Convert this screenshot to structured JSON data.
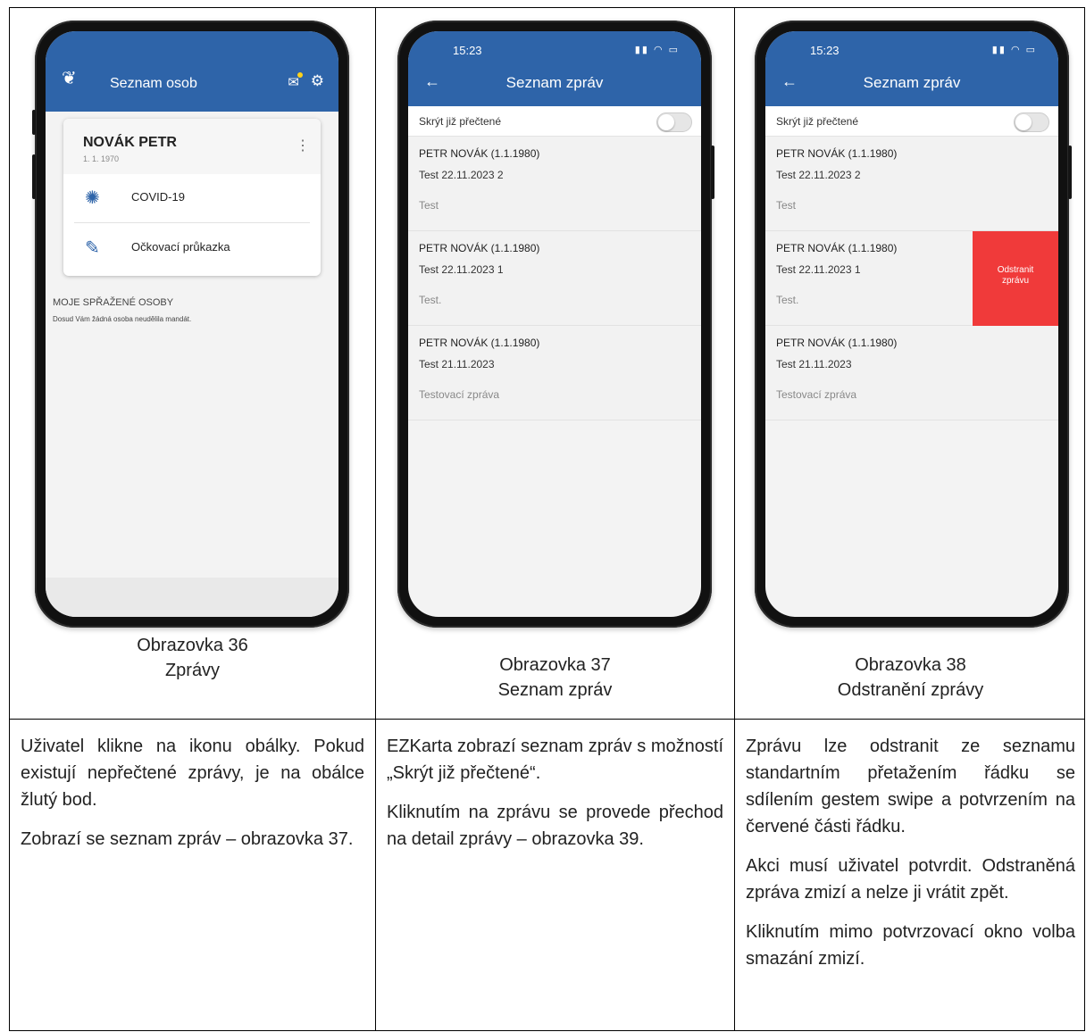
{
  "screens": [
    {
      "caption_line1": "Obrazovka 36",
      "caption_line2": "Zprávy",
      "app_title": "Seznam osob",
      "person_name": "NOVÁK PETR",
      "person_date": "1. 1. 1970",
      "items": [
        "COVID-19",
        "Očkovací průkazka"
      ],
      "linked_title": "MOJE SPŘAŽENÉ OSOBY",
      "linked_text": "Dosud Vám žádná osoba neudělila mandát.",
      "description": [
        "Uživatel klikne na ikonu obálky. Pokud existují nepřečtené zprávy, je na obálce žlutý bod.",
        "Zobrazí se seznam zpráv – obrazovka 37."
      ]
    },
    {
      "caption_line1": "Obrazovka 37",
      "caption_line2": "Seznam zpráv",
      "status_time": "15:23",
      "app_title": "Seznam zpráv",
      "toggle_label": "Skrýt již přečtené",
      "messages": [
        {
          "sender": "PETR NOVÁK (1.1.1980)",
          "subject": "Test 22.11.2023 2",
          "body": "Test"
        },
        {
          "sender": "PETR NOVÁK (1.1.1980)",
          "subject": "Test 22.11.2023 1",
          "body": "Test."
        },
        {
          "sender": "PETR NOVÁK (1.1.1980)",
          "subject": "Test 21.11.2023",
          "body": "Testovací zpráva"
        }
      ],
      "description": [
        "EZKarta zobrazí seznam zpráv s možností „Skrýt již přečtené“.",
        "Kliknutím na zprávu se provede přechod na detail zprávy – obrazovka 39."
      ]
    },
    {
      "caption_line1": "Obrazovka 38",
      "caption_line2": "Odstranění zprávy",
      "status_time": "15:23",
      "app_title": "Seznam zpráv",
      "toggle_label": "Skrýt již přečtené",
      "messages": [
        {
          "sender": "PETR NOVÁK (1.1.1980)",
          "subject": "Test 22.11.2023 2",
          "body": "Test"
        },
        {
          "sender": "PETR NOVÁK (1.1.1980)",
          "subject": "Test 22.11.2023 1",
          "body": "Test."
        },
        {
          "sender": "PETR NOVÁK (1.1.1980)",
          "subject": "Test 21.11.2023",
          "body": "Testovací zpráva"
        }
      ],
      "delete_label_line1": "Odstranit",
      "delete_label_line2": "zprávu",
      "description": [
        "Zprávu lze odstranit ze seznamu standartním přetažením řádku se sdílením gestem swipe a potvrzením na červené části řádku.",
        "Akci musí uživatel potvrdit. Odstraněná zpráva zmizí a nelze ji vrátit zpět.",
        "Kliknutím mimo potvrzovací okno volba smazání zmizí."
      ]
    }
  ],
  "colors": {
    "app_bar": "#2e64a9",
    "delete": "#f03a3a",
    "unread_dot": "#ffd11a"
  }
}
